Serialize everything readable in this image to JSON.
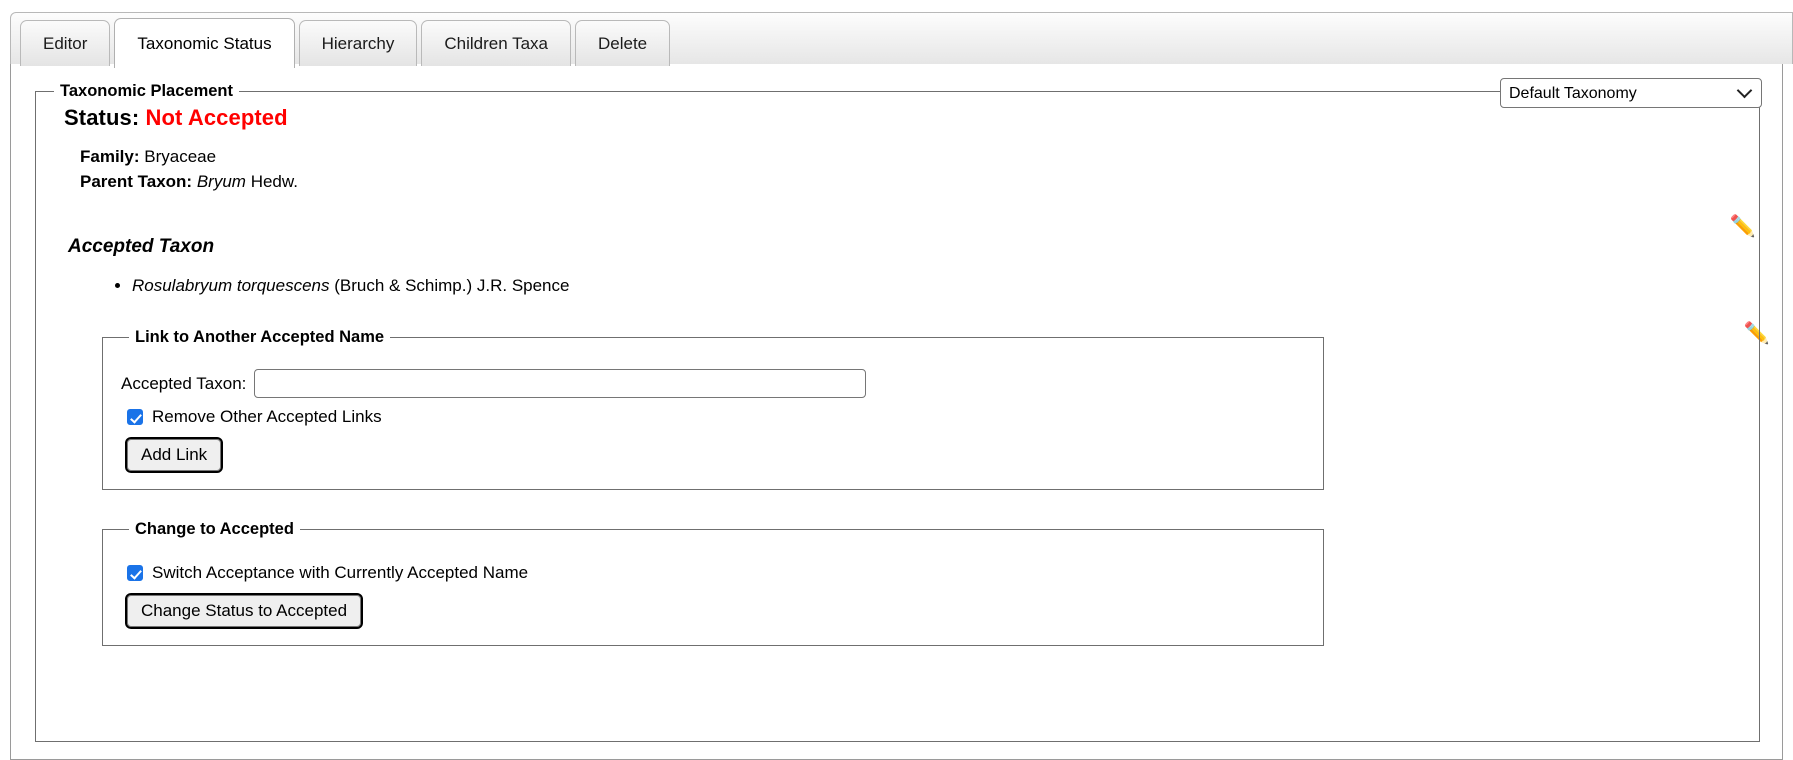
{
  "tabs": [
    {
      "label": "Editor",
      "active": false
    },
    {
      "label": "Taxonomic Status",
      "active": true
    },
    {
      "label": "Hierarchy",
      "active": false
    },
    {
      "label": "Children Taxa",
      "active": false
    },
    {
      "label": "Delete",
      "active": false
    }
  ],
  "taxonomy_select": {
    "selected": "Default Taxonomy",
    "options": [
      "Default Taxonomy"
    ]
  },
  "placement": {
    "legend": "Taxonomic Placement",
    "status_label": "Status:",
    "status_value": "Not Accepted",
    "status_color": "#ff0000",
    "family_label": "Family:",
    "family_value": "Bryaceae",
    "parent_label": "Parent Taxon:",
    "parent_name": "Bryum",
    "parent_author": "Hedw."
  },
  "accepted": {
    "heading": "Accepted Taxon",
    "items": [
      {
        "name": "Rosulabryum torquescens",
        "author": "(Bruch & Schimp.) J.R. Spence"
      }
    ]
  },
  "link_fieldset": {
    "legend": "Link to Another Accepted Name",
    "input_label": "Accepted Taxon:",
    "input_value": "",
    "input_placeholder": "",
    "checkbox_label": "Remove Other Accepted Links",
    "checkbox_checked": true,
    "button_label": "Add Link"
  },
  "change_fieldset": {
    "legend": "Change to Accepted",
    "checkbox_label": "Switch Acceptance with Currently Accepted Name",
    "checkbox_checked": true,
    "button_label": "Change Status to Accepted"
  },
  "icons": {
    "edit_placement": "✏️",
    "edit_accepted": "✏️"
  }
}
